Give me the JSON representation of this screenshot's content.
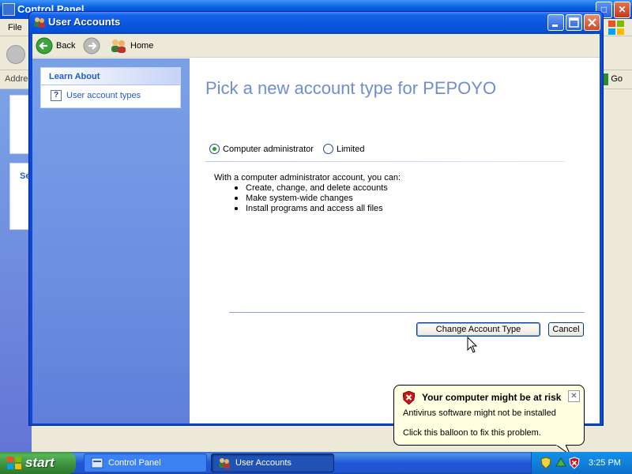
{
  "background_window": {
    "title": "Control Panel",
    "menu_first": "File",
    "address_label": "Address",
    "go_label": "Go",
    "section_prefix": "Se"
  },
  "window": {
    "title": "User Accounts"
  },
  "nav": {
    "back_label": "Back",
    "home_label": "Home"
  },
  "sidebar": {
    "learn_about_title": "Learn About",
    "items": [
      {
        "label": "User account types",
        "icon": "help-icon"
      }
    ]
  },
  "main": {
    "heading": "Pick a new account type for PEPOYO",
    "options": [
      {
        "label": "Computer administrator",
        "selected": true
      },
      {
        "label": "Limited",
        "selected": false
      }
    ],
    "description": "With a computer administrator account, you can:",
    "bullets": [
      "Create, change, and delete accounts",
      "Make system-wide changes",
      "Install programs and access all files"
    ],
    "change_button": "Change Account Type",
    "cancel_button": "Cancel"
  },
  "balloon": {
    "title": "Your computer might be at risk",
    "line1": "Antivirus software might not be installed",
    "line2": "Click this balloon to fix this problem.",
    "icon": "shield-warning-icon"
  },
  "taskbar": {
    "start_label": "start",
    "tasks": [
      {
        "label": "Control Panel",
        "active": false
      },
      {
        "label": "User Accounts",
        "active": true
      }
    ],
    "clock": "3:25 PM"
  },
  "colors": {
    "title_blue": "#0a58e0",
    "heading": "#6f8dd3",
    "link": "#215dc6",
    "balloon_bg": "#ffffe1"
  }
}
